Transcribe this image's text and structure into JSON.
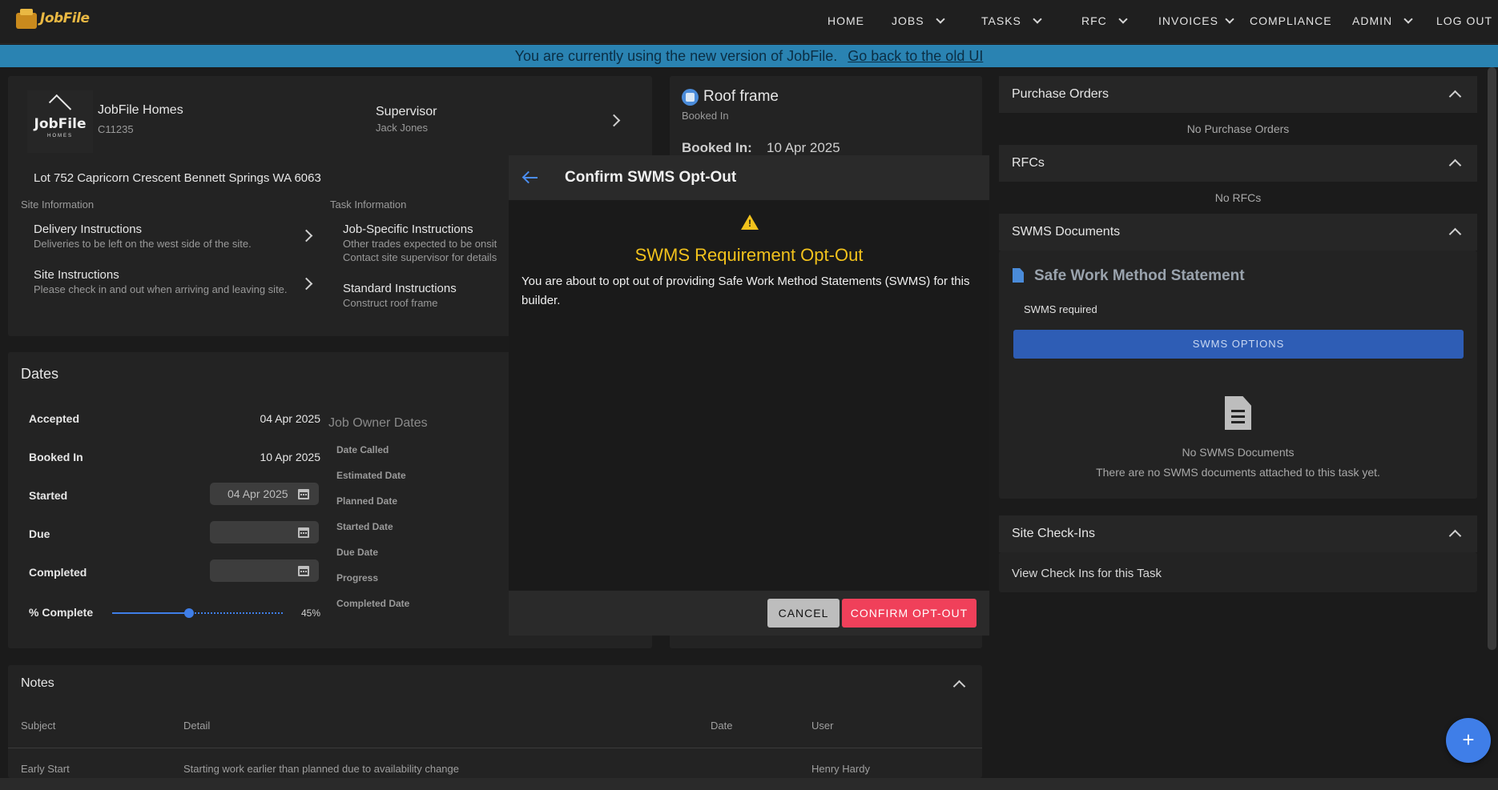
{
  "nav": {
    "logo_text": "JobFile",
    "items": [
      {
        "label": "HOME"
      },
      {
        "label": "JOBS"
      },
      {
        "label": "TASKS"
      },
      {
        "label": "RFC"
      },
      {
        "label": "INVOICES"
      },
      {
        "label": "COMPLIANCE"
      },
      {
        "label": "ADMIN"
      },
      {
        "label": "LOG OUT"
      }
    ]
  },
  "banner": {
    "text": "You are currently using the new version of JobFile.",
    "link": "Go back to the old UI"
  },
  "job_card": {
    "builder_logo_text": "JobFile",
    "builder_logo_sub": "HOMES",
    "builder_name": "JobFile Homes",
    "builder_code": "C11235",
    "supervisor_label": "Supervisor",
    "supervisor_name": "Jack Jones",
    "address": "Lot 752 Capricorn Crescent Bennett Springs WA 6063",
    "site_info_label": "Site Information",
    "task_info_label": "Task Information",
    "delivery_title": "Delivery Instructions",
    "delivery_text": "Deliveries to be left on the west side of the site.",
    "site_instr_title": "Site Instructions",
    "site_instr_text": "Please check in and out when arriving and leaving site.",
    "job_specific_title": "Job-Specific Instructions",
    "job_specific_text1": "Other trades expected to be onsit",
    "job_specific_text2": "Contact site supervisor for details",
    "standard_title": "Standard Instructions",
    "standard_text": "Construct roof frame"
  },
  "dates": {
    "title": "Dates",
    "accepted_label": "Accepted",
    "accepted_value": "04 Apr 2025",
    "booked_label": "Booked In",
    "booked_value": "10 Apr 2025",
    "started_label": "Started",
    "started_value": "04 Apr 2025",
    "due_label": "Due",
    "due_value": "",
    "completed_label": "Completed",
    "completed_value": "",
    "percent_label": "% Complete",
    "percent_value": "45%",
    "percent_fraction": 0.45,
    "job_owner_title": "Job Owner Dates",
    "job_owner_labels": [
      "Date Called",
      "Estimated Date",
      "Planned Date",
      "Started Date",
      "Due Date",
      "Progress",
      "Completed Date"
    ]
  },
  "task_card": {
    "title": "Roof frame",
    "status": "Booked In",
    "booked_label": "Booked In:",
    "booked_value": "10 Apr 2025"
  },
  "modal": {
    "title": "Confirm SWMS Opt-Out",
    "heading": "SWMS Requirement Opt-Out",
    "body": "You are about to opt out of providing Safe Work Method Statements (SWMS) for this builder.",
    "cancel": "CANCEL",
    "confirm": "CONFIRM OPT-OUT"
  },
  "right": {
    "po_title": "Purchase Orders",
    "po_empty": "No Purchase Orders",
    "rfc_title": "RFCs",
    "rfc_empty": "No RFCs",
    "swms_title": "SWMS Documents",
    "swms_doc_title": "Safe Work Method Statement",
    "swms_required": "SWMS required",
    "swms_options": "SWMS OPTIONS",
    "swms_empty_title": "No SWMS Documents",
    "swms_empty_text": "There are no SWMS documents attached to this task yet.",
    "checkin_title": "Site Check-Ins",
    "checkin_link": "View Check Ins for this Task"
  },
  "notes": {
    "title": "Notes",
    "columns": [
      "Subject",
      "Detail",
      "Date",
      "User"
    ],
    "rows": [
      {
        "subject": "Early Start",
        "detail": "Starting work earlier than planned due to availability change",
        "date": "",
        "user": "Henry Hardy"
      }
    ]
  },
  "colors": {
    "accent_blue": "#3f7ee8",
    "warning_yellow": "#f2c21c",
    "confirm_red": "#f0405a",
    "banner_blue": "#2a83b2"
  },
  "icons": {
    "back": "arrow-left-icon",
    "warning": "warning-triangle-icon",
    "document": "document-icon",
    "calendar": "calendar-icon",
    "add": "plus-icon"
  }
}
